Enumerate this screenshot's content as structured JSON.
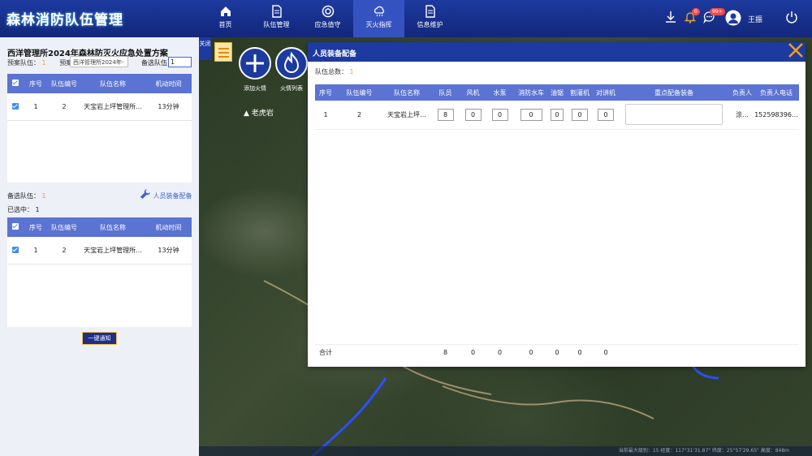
{
  "app": {
    "title": "森林消防队伍管理"
  },
  "nav": [
    {
      "label": "首页",
      "icon": "home-icon"
    },
    {
      "label": "队伍管理",
      "icon": "document-icon"
    },
    {
      "label": "应急值守",
      "icon": "lifebuoy-icon"
    },
    {
      "label": "灭火指挥",
      "icon": "weather-cloud-icon",
      "active": true
    },
    {
      "label": "信息维护",
      "icon": "document-icon"
    }
  ],
  "header": {
    "notifications_badge": "0",
    "messages_badge": "99+",
    "username": "王振"
  },
  "left": {
    "plan_title": "西洋管理所2024年森林防灭火应急处置方案",
    "plan_team_label": "预案队伍：",
    "plan_team_count": "1",
    "plan_label": "预案",
    "plan_select": "西洋管理所2024年",
    "backup_label": "备选队伍",
    "backup_input": "1",
    "table_headers": [
      "序号",
      "队伍编号",
      "队伍名称",
      "机动时间"
    ],
    "plan_rows": [
      {
        "index": "1",
        "code": "2",
        "name": "天宝岩上坪管理所...",
        "time": "13分钟"
      }
    ],
    "backup_team_label": "备选队伍：",
    "backup_team_count": "1",
    "selected_label": "已选中：",
    "selected_count": "1",
    "equip_link": "人员装备配备",
    "selected_rows": [
      {
        "index": "1",
        "code": "2",
        "name": "天宝岩上坪管理所...",
        "time": "13分钟"
      }
    ],
    "notify_button": "一键通知"
  },
  "map": {
    "close_side": "关闭",
    "add_fire": "添加火情",
    "fire_list": "火情列表",
    "place_label": "老虎岩",
    "status": "当前最大级别：15   经度：117°31'31.87\"  纬度：25°57'29.65\"  高度：848m"
  },
  "modal": {
    "title": "人员装备配备",
    "total_label": "队伍总数：",
    "total_count": "1",
    "headers": [
      "序号",
      "队伍编号",
      "队伍名称",
      "队员",
      "风机",
      "水泵",
      "消防水车",
      "油锯",
      "割灌机",
      "对讲机",
      "重点配备装备",
      "负责人",
      "负责人电话"
    ],
    "rows": [
      {
        "index": "1",
        "code": "2",
        "name": "天宝岩上坪…",
        "members": "8",
        "blower": "0",
        "pump": "0",
        "water_truck": "0",
        "chainsaw": "0",
        "brush_cutter": "0",
        "radio": "0",
        "remark": "",
        "leader": "涂…",
        "phone": "152598396…"
      }
    ],
    "footer": {
      "label": "合计",
      "members": "8",
      "blower": "0",
      "pump": "0",
      "water_truck": "0",
      "chainsaw": "0",
      "brush_cutter": "0",
      "radio": "0"
    }
  }
}
